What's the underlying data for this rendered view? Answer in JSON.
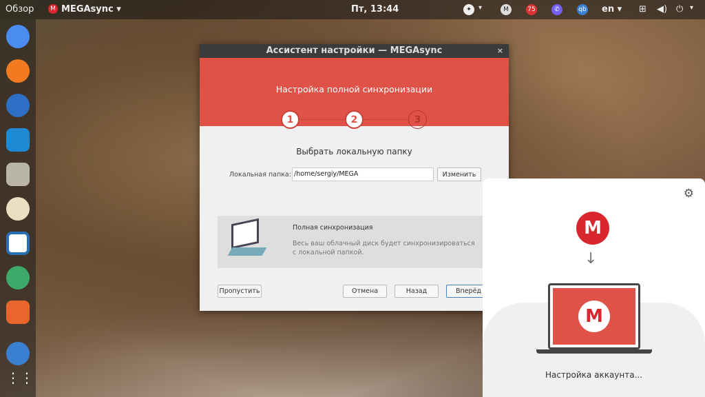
{
  "topbar": {
    "overview": "Обзор",
    "app": "MEGAsync ▾",
    "clock": "Пт, 13:44",
    "lang": "en ▾",
    "badge": "75",
    "qb": "qb",
    "arrow": "▾"
  },
  "dialog": {
    "title": "Ассистент настройки — MEGAsync",
    "close": "×",
    "header": "Настройка полной синхронизации",
    "steps": [
      "1",
      "2",
      "3"
    ],
    "section_title": "Выбрать локальную папку",
    "folder_label": "Локальная папка:",
    "folder_value": "/home/sergiy/MEGA",
    "change": "Изменить",
    "info_title": "Полная синхронизация",
    "info_text": "Весь ваш облачный диск будет синхронизироваться с локальной папкой.",
    "skip": "Пропустить",
    "cancel": "Отмена",
    "back": "Назад",
    "next": "Вперёд"
  },
  "panel": {
    "status": "Настройка аккаунта...",
    "logo": "M",
    "gear": "⚙",
    "arrow": "↓"
  },
  "colors": {
    "accent": "#e05248",
    "mega": "#d9272e"
  }
}
